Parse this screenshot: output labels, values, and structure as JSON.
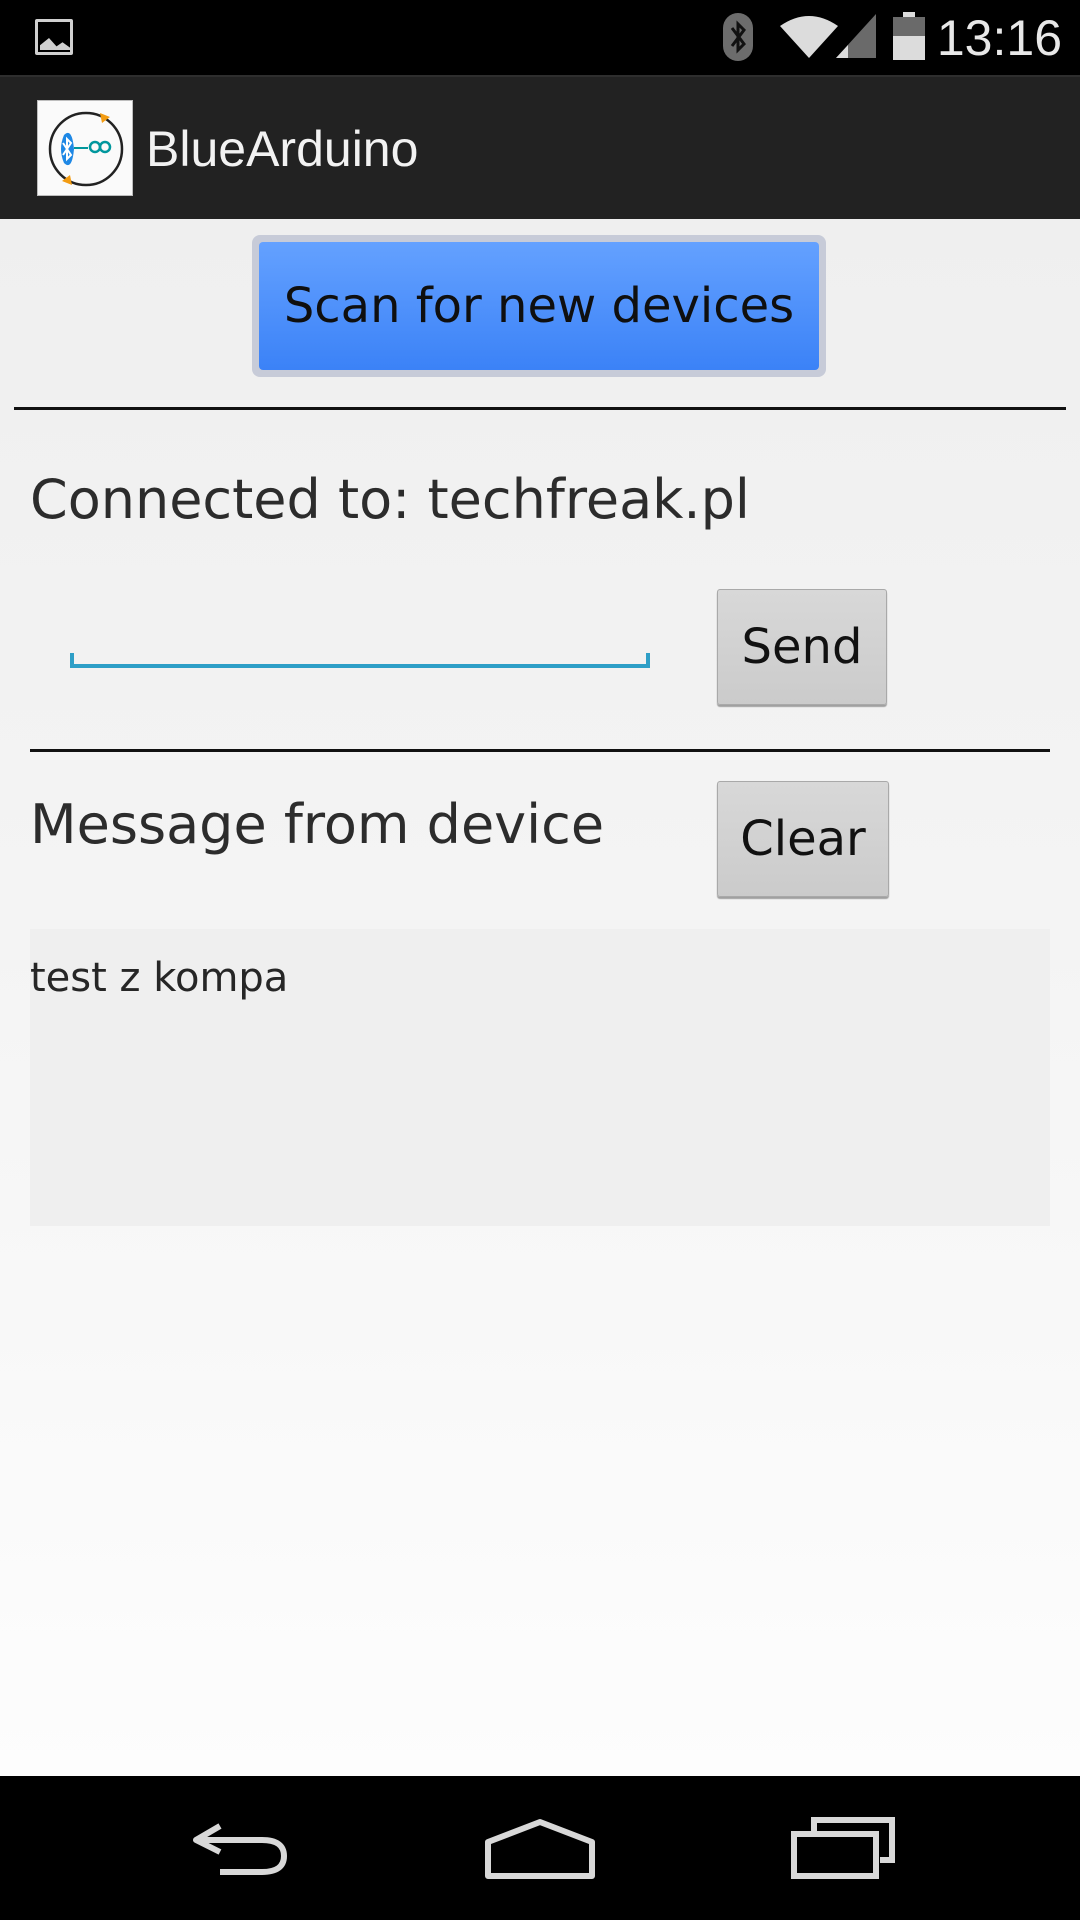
{
  "status_bar": {
    "time": "13:16",
    "icons": [
      "gallery-notification-icon",
      "bluetooth-icon",
      "wifi-icon",
      "cell-signal-icon",
      "battery-icon"
    ]
  },
  "action_bar": {
    "title": "BlueArduino",
    "icon": "app-logo-icon"
  },
  "main": {
    "scan_button_label": "Scan for new devices",
    "connected_label": "Connected to: techfreak.pl",
    "input_value": "",
    "send_button_label": "Send",
    "message_section_label": "Message from device",
    "clear_button_label": "Clear",
    "received_message": "test z kompa"
  },
  "nav_bar": {
    "icons": [
      "back-icon",
      "home-icon",
      "recents-icon"
    ]
  },
  "colors": {
    "accent_blue": "#3b82f7",
    "input_underline": "#2e9fc7",
    "action_bar_bg": "#222222",
    "status_bar_bg": "#000000"
  }
}
